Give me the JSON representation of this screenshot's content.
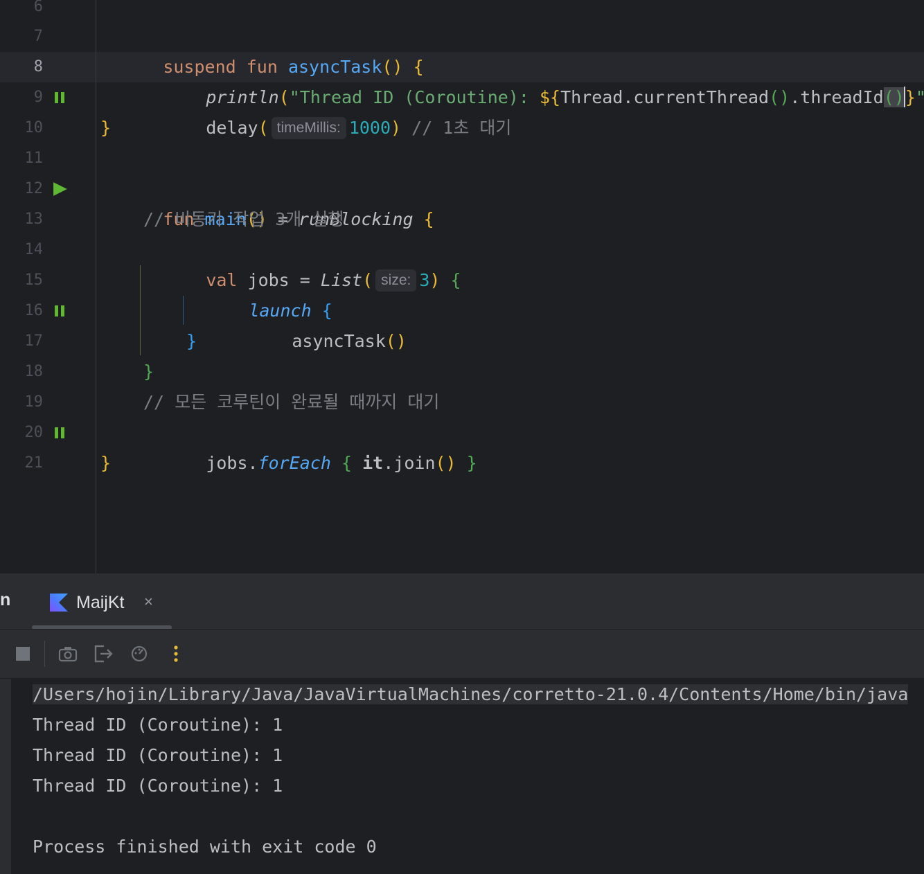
{
  "editor": {
    "lines": [
      {
        "n": "6"
      },
      {
        "n": "7"
      },
      {
        "n": "8"
      },
      {
        "n": "9"
      },
      {
        "n": "10"
      },
      {
        "n": "11"
      },
      {
        "n": "12"
      },
      {
        "n": "13"
      },
      {
        "n": "14"
      },
      {
        "n": "15"
      },
      {
        "n": "16"
      },
      {
        "n": "17"
      },
      {
        "n": "18"
      },
      {
        "n": "19"
      },
      {
        "n": "20"
      },
      {
        "n": "21"
      }
    ],
    "code": {
      "l7": {
        "kw1": "suspend",
        "kw2": "fun",
        "fn": "asyncTask",
        "paren": "()",
        "brace": "{"
      },
      "l8": {
        "fn": "println",
        "lp": "(",
        "str": "\"Thread ID (Coroutine): ",
        "tpl": "${",
        "expr1": "Thread.currentThread",
        "p1": "()",
        "expr2": ".threadId",
        "p2l": "(",
        "p2r": ")",
        "tplend": "}",
        "strend": "\"",
        "rp": ")"
      },
      "l9": {
        "fn": "delay",
        "lp": "(",
        "hint": "timeMillis:",
        "num": "1000",
        "rp": ")",
        "comment": "// 1초 대기"
      },
      "l10": {
        "brace": "}"
      },
      "l12": {
        "kw": "fun",
        "fn": "main",
        "paren": "()",
        "eq": " = ",
        "call": "runBlocking",
        "brace": "{"
      },
      "l13": {
        "comment": "// 비동기 작업 3개 실행"
      },
      "l14": {
        "kw": "val",
        "name": " jobs = ",
        "call": "List",
        "lp": "(",
        "hint": "size:",
        "num": "3",
        "rp": ")",
        "brace": "{"
      },
      "l15": {
        "call": "launch",
        "brace": "{"
      },
      "l16": {
        "text": "asyncTask",
        "paren": "()"
      },
      "l17": {
        "brace": "}"
      },
      "l18": {
        "brace": "}"
      },
      "l19": {
        "comment": "// 모든 코루틴이 완료될 때까지 대기"
      },
      "l20": {
        "obj": "jobs.",
        "call": "forEach",
        "lb": "{",
        "it": "it",
        "rest": ".join",
        "paren": "()",
        "rb": "}"
      },
      "l21": {
        "brace": "}"
      }
    }
  },
  "toolwindow": {
    "prev_tab_fragment": "n",
    "tab_label": "MaijKt",
    "close_glyph": "×",
    "toolbar": {
      "stop": "stop-icon",
      "screenshot": "camera-icon",
      "exit": "exit-icon",
      "profiler": "profiler-icon",
      "more": "more-vertical-icon"
    }
  },
  "console": {
    "path_line": "/Users/hojin/Library/Java/JavaVirtualMachines/corretto-21.0.4/Contents/Home/bin/java",
    "outputs": [
      "Thread ID (Coroutine): 1",
      "Thread ID (Coroutine): 1",
      "Thread ID (Coroutine): 1"
    ],
    "finish": "Process finished with exit code 0"
  },
  "colors": {
    "background": "#1e1f22",
    "keyword": "#cf8e6d",
    "function": "#56a8f5",
    "string": "#6aab73",
    "number": "#2aacb8",
    "comment": "#7a7e85",
    "run_icon": "#5fb832"
  }
}
